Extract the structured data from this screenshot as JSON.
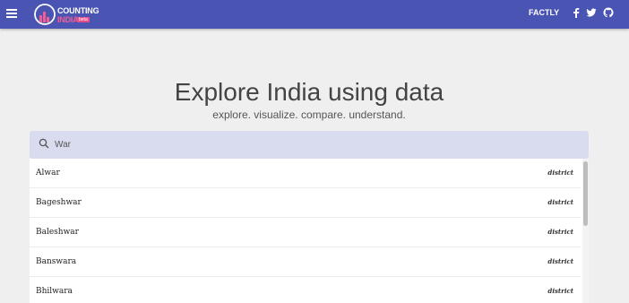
{
  "header": {
    "logo_line1": "COUNTING",
    "logo_line2": "INDIA",
    "logo_badge": "beta",
    "nav_link": "FACTLY",
    "social_icons": [
      "facebook-icon",
      "twitter-icon",
      "github-icon"
    ]
  },
  "hero": {
    "title": "Explore India using data",
    "subtitle": "explore. visualize. compare. understand."
  },
  "search": {
    "value": "War",
    "placeholder": ""
  },
  "results": [
    {
      "name": "Alwar",
      "type": "district"
    },
    {
      "name": "Bageshwar",
      "type": "district"
    },
    {
      "name": "Baleshwar",
      "type": "district"
    },
    {
      "name": "Banswara",
      "type": "district"
    },
    {
      "name": "Bhilwara",
      "type": "district"
    }
  ],
  "colors": {
    "header_bg": "#4a55b3",
    "accent_pink": "#f25e93",
    "search_bg": "#d9dcef"
  }
}
